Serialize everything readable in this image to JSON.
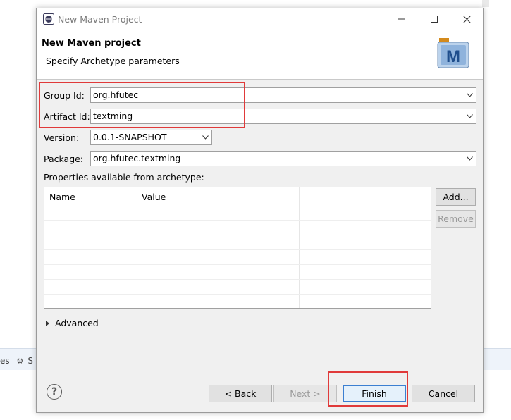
{
  "window": {
    "title": "New Maven Project",
    "min": "—",
    "max": "☐",
    "close": "✕"
  },
  "header": {
    "title": "New Maven project",
    "subtitle": "Specify Archetype parameters",
    "logo_letter": "M"
  },
  "form": {
    "group_id_label": "Group Id:",
    "group_id_value": "org.hfutec",
    "artifact_id_label": "Artifact Id:",
    "artifact_id_value": "textming",
    "version_label": "Version:",
    "version_value": "0.0.1-SNAPSHOT",
    "package_label": "Package:",
    "package_value": "org.hfutec.textming",
    "properties_label": "Properties available from archetype:"
  },
  "properties_table": {
    "columns": [
      "Name",
      "Value"
    ],
    "rows": []
  },
  "side_buttons": {
    "add": "Add...",
    "remove": "Remove"
  },
  "advanced_label": "Advanced",
  "footer": {
    "help": "?",
    "back": "< Back",
    "next": "Next >",
    "finish": "Finish",
    "cancel": "Cancel"
  },
  "background": {
    "tab_fragment_1": "es",
    "tab_fragment_2": "S"
  },
  "colors": {
    "highlight": "#e03a3a",
    "default_button_border": "#3c7fd1",
    "dialog_bg": "#f0f0f0"
  }
}
